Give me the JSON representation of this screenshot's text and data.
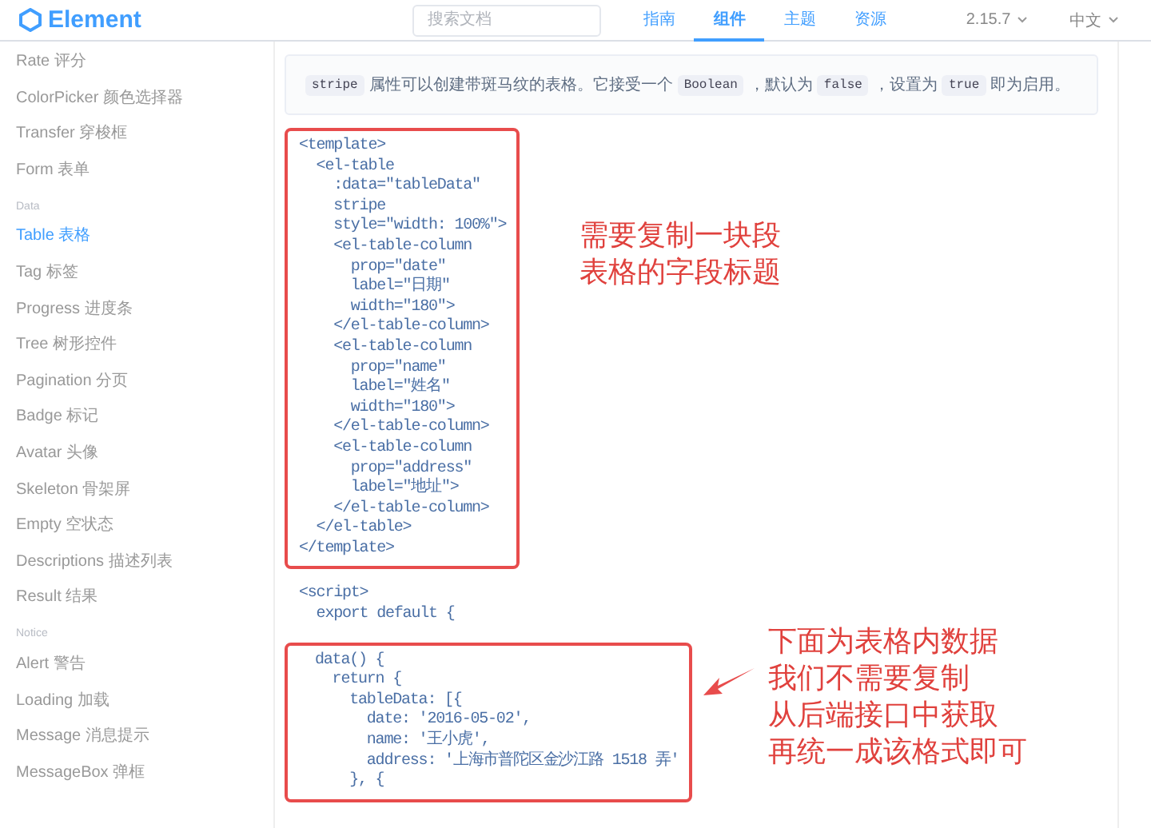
{
  "header": {
    "logo": "Element",
    "search": {
      "placeholder": "搜索文档"
    },
    "nav": [
      {
        "label": "指南",
        "selected": false
      },
      {
        "label": "组件",
        "selected": true
      },
      {
        "label": "主题",
        "selected": false
      },
      {
        "label": "资源",
        "selected": false
      }
    ],
    "version": "2.15.7",
    "language": "中文"
  },
  "sidebar": {
    "groups": [
      {
        "items": [
          {
            "label": "Rate 评分",
            "selected": false
          },
          {
            "label": "ColorPicker 颜色选择器",
            "selected": false
          },
          {
            "label": "Transfer 穿梭框",
            "selected": false
          },
          {
            "label": "Form 表单",
            "selected": false
          }
        ]
      },
      {
        "title": "Data",
        "items": [
          {
            "label": "Table 表格",
            "selected": true
          },
          {
            "label": "Tag 标签",
            "selected": false
          },
          {
            "label": "Progress 进度条",
            "selected": false
          },
          {
            "label": "Tree 树形控件",
            "selected": false
          },
          {
            "label": "Pagination 分页",
            "selected": false
          },
          {
            "label": "Badge 标记",
            "selected": false
          },
          {
            "label": "Avatar 头像",
            "selected": false
          },
          {
            "label": "Skeleton 骨架屏",
            "selected": false
          },
          {
            "label": "Empty 空状态",
            "selected": false
          },
          {
            "label": "Descriptions 描述列表",
            "selected": false
          },
          {
            "label": "Result 结果",
            "selected": false
          }
        ]
      },
      {
        "title": "Notice",
        "items": [
          {
            "label": "Alert 警告",
            "selected": false
          },
          {
            "label": "Loading 加载",
            "selected": false
          },
          {
            "label": "Message 消息提示",
            "selected": false
          },
          {
            "label": "MessageBox 弹框",
            "selected": false
          }
        ]
      }
    ]
  },
  "description": [
    {
      "kind": "code",
      "text": "stripe"
    },
    {
      "kind": "text",
      "text": "属性可以创建带斑马纹的表格。它接受一个"
    },
    {
      "kind": "code",
      "text": "Boolean"
    },
    {
      "kind": "text",
      "text": "，默认为"
    },
    {
      "kind": "code",
      "text": "false"
    },
    {
      "kind": "text",
      "text": "，设置为"
    },
    {
      "kind": "code",
      "text": "true"
    },
    {
      "kind": "text",
      "text": "即为启用。"
    }
  ],
  "code_sections": [
    {
      "kind": "highlight",
      "note": [
        "需要复制一块段",
        "表格的字段标题"
      ],
      "lines": [
        "<template>",
        "  <el-table",
        "    :data=\"tableData\"",
        "    stripe",
        "    style=\"width: 100%\">",
        "    <el-table-column",
        "      prop=\"date\"",
        "      label=\"日期\"",
        "      width=\"180\">",
        "    </el-table-column>",
        "    <el-table-column",
        "      prop=\"name\"",
        "      label=\"姓名\"",
        "      width=\"180\">",
        "    </el-table-column>",
        "    <el-table-column",
        "      prop=\"address\"",
        "      label=\"地址\">",
        "    </el-table-column>",
        "  </el-table>",
        "</template>"
      ]
    },
    {
      "kind": "plain",
      "lines": [
        "<script>",
        "  export default {"
      ]
    },
    {
      "kind": "highlight",
      "arrow": true,
      "note": [
        "下面为表格内数据",
        "我们不需要复制",
        "从后端接口中获取",
        "再统一成该格式即可"
      ],
      "lines": [
        "data() {",
        "  return {",
        "    tableData: [{",
        "      date: '2016-05-02',",
        "      name: '王小虎',",
        "      address: '上海市普陀区金沙江路 1518 弄'",
        "    }, {"
      ]
    }
  ]
}
